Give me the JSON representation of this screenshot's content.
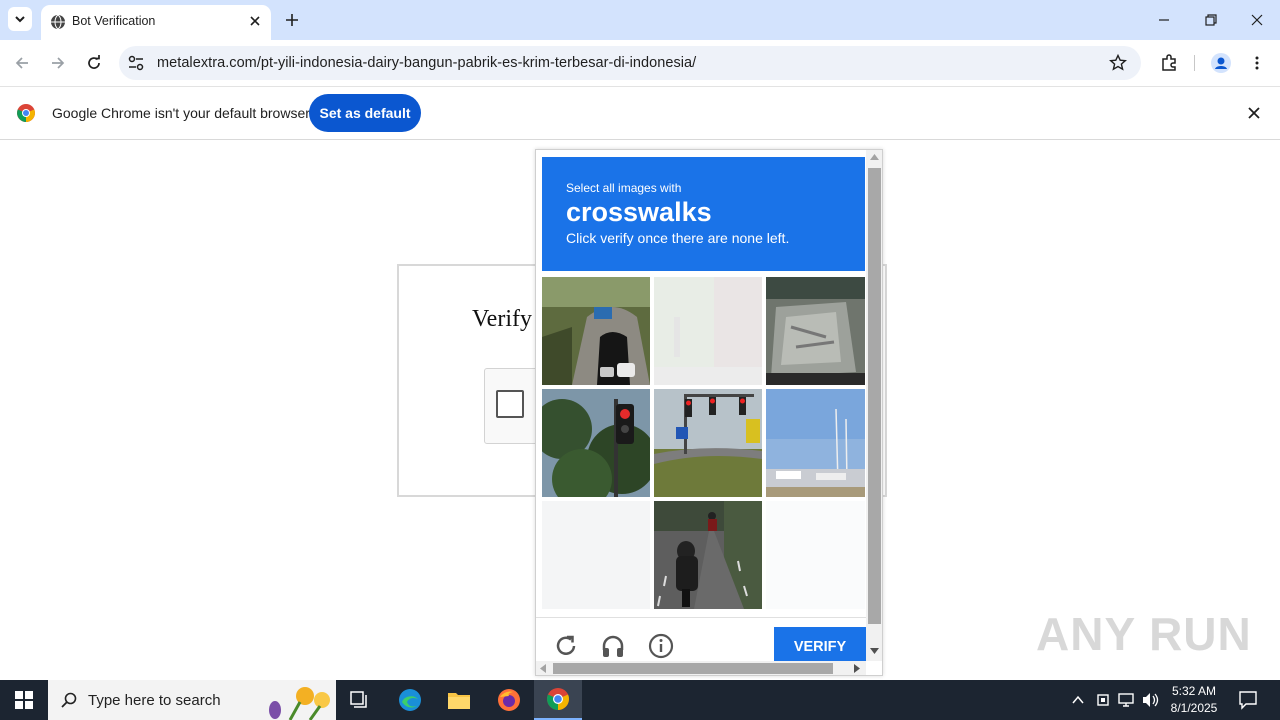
{
  "browser": {
    "tab_title": "Bot Verification",
    "url": "metalextra.com/pt-yili-indonesia-dairy-bangun-pabrik-es-krim-terbesar-di-indonesia/"
  },
  "infobar": {
    "message": "Google Chrome isn't your default browser",
    "button_label": "Set as default"
  },
  "page": {
    "heading": "Verify"
  },
  "captcha": {
    "instruction": "Select all images with",
    "target": "crosswalks",
    "subtext": "Click verify once there are none left.",
    "verify_label": "VERIFY",
    "tiles": [
      {
        "desc": "tunnel",
        "faded": false
      },
      {
        "desc": "faded",
        "faded": true
      },
      {
        "desc": "garbage-truck",
        "faded": false
      },
      {
        "desc": "traffic-light-trees",
        "faded": false
      },
      {
        "desc": "traffic-light-road",
        "faded": false
      },
      {
        "desc": "harbor",
        "faded": false
      },
      {
        "desc": "empty",
        "faded": true
      },
      {
        "desc": "motorcycle",
        "faded": false
      },
      {
        "desc": "empty",
        "faded": true
      }
    ]
  },
  "watermark": "ANY RUN",
  "taskbar": {
    "search_placeholder": "Type here to search",
    "time": "5:32 AM",
    "date": "8/1/2025"
  },
  "colors": {
    "captcha_blue": "#1a73e8",
    "chrome_button_blue": "#0b57d0",
    "tabstrip_bg": "#d3e3fd"
  }
}
